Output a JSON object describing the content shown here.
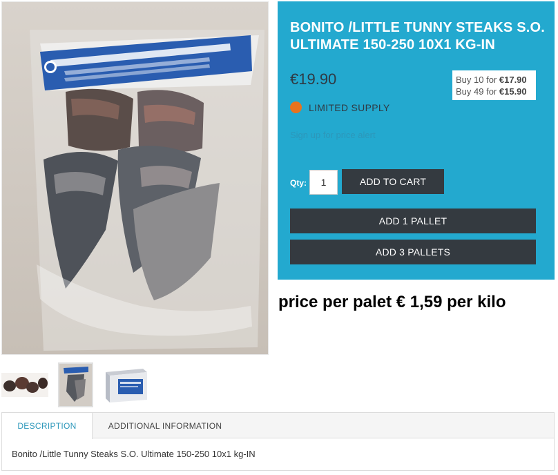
{
  "product": {
    "title": "BONITO /LITTLE TUNNY STEAKS S.O. ULTIMATE 150-250 10X1 KG-IN",
    "price": "€19.90",
    "tier_pricing": [
      {
        "label": "Buy 10 for ",
        "price": "€17.90"
      },
      {
        "label": "Buy 49 for ",
        "price": "€15.90"
      }
    ],
    "stock_status": "LIMITED SUPPLY",
    "stock_color": "#e8731e",
    "price_alert_link": "Sign up for price alert",
    "qty_label": "Qty:",
    "qty_value": "1",
    "add_to_cart_label": "ADD TO CART",
    "add_1_pallet_label": "ADD 1 PALLET",
    "add_3_pallets_label": "ADD 3 PALLETS",
    "pallet_price_note": "price per palet € 1,59 per kilo",
    "accent_color": "#23a9cf",
    "button_color": "#343a40"
  },
  "gallery": {
    "thumbnails": [
      {
        "name": "bonito steaks loose"
      },
      {
        "name": "bonito steaks bag"
      },
      {
        "name": "product box"
      }
    ]
  },
  "tabs": {
    "items": [
      {
        "label": "DESCRIPTION",
        "active": true
      },
      {
        "label": "ADDITIONAL INFORMATION",
        "active": false
      }
    ],
    "description_text": "Bonito /Little Tunny Steaks S.O. Ultimate 150-250 10x1 kg-IN"
  }
}
